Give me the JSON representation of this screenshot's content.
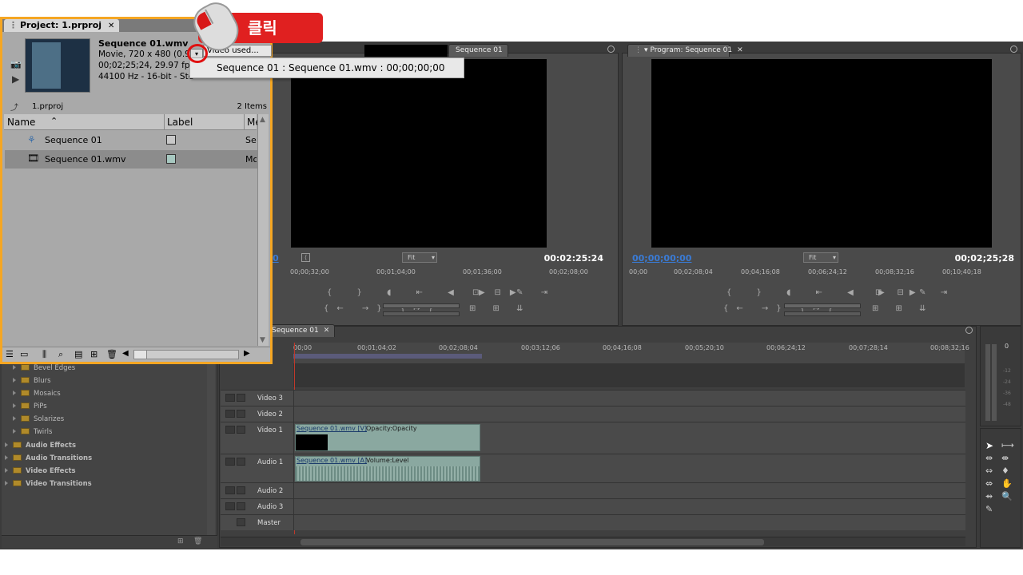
{
  "project_panel": {
    "tab_title": "Project: 1.prproj",
    "clip_name": "Sequence 01.wmv",
    "clip_line1": "Movie, 720 x 480 (0.9)",
    "clip_line2": "00;02;25;24, 29.97 fps",
    "clip_line3": "44100 Hz - 16-bit - Ste",
    "project_file": "1.prproj",
    "item_count": "2 Items",
    "columns": [
      "Name",
      "Label",
      "Me"
    ],
    "items": [
      {
        "name": "Sequence 01",
        "media": "Seq",
        "label_color": "#c8c8c8"
      },
      {
        "name": "Sequence 01.wmv",
        "media": "Mo",
        "label_color": "#a7c8c0"
      }
    ]
  },
  "dropdown": {
    "header": "Video used...",
    "item": "Sequence 01 : Sequence 01.wmv : 00;00;00;00"
  },
  "callout": {
    "label": "클릭"
  },
  "source_monitor": {
    "tab_label": "Sequence 01",
    "timecode_left": "0",
    "timecode_right": "00:02:25:24",
    "fit": "Fit",
    "ruler": [
      "00;00;32;00",
      "00;01;04;00",
      "00;01;36;00",
      "00;02;08;00"
    ]
  },
  "program_monitor": {
    "tab_label": "Program: Sequence 01",
    "timecode_left": "00;00;00;00",
    "timecode_right": "00;02;25;28",
    "fit": "Fit",
    "ruler": [
      "00;00",
      "00;02;08;04",
      "00;04;16;08",
      "00;06;24;12",
      "00;08;32;16",
      "00;10;40;18"
    ]
  },
  "timeline": {
    "tab_label": "Sequence 01",
    "ruler": [
      "00;00",
      "00;01;04;02",
      "00;02;08;04",
      "00;03;12;06",
      "00;04;16;08",
      "00;05;20;10",
      "00;06;24;12",
      "00;07;28;14",
      "00;08;32;16"
    ],
    "tracks": {
      "video3": "Video 3",
      "video2": "Video 2",
      "video1": "Video 1",
      "audio1": "Audio 1",
      "audio2": "Audio 2",
      "audio3": "Audio 3",
      "master": "Master"
    },
    "video_clip": {
      "name": "Sequence 01.wmv [V]",
      "effect": "Opacity:Opacity"
    },
    "audio_clip": {
      "name": "Sequence 01.wmv [A]",
      "effect": "Volume:Level"
    }
  },
  "effects_panel": {
    "sub_items": [
      "Bevel Edges",
      "Blurs",
      "Mosaics",
      "PiPs",
      "Solarizes",
      "Twirls"
    ],
    "categories": [
      "Audio Effects",
      "Audio Transitions",
      "Video Effects",
      "Video Transitions"
    ]
  },
  "audio_meter": {
    "zero_label": "0",
    "db_labels": [
      "-12",
      "-24",
      "-36",
      "-48"
    ]
  }
}
